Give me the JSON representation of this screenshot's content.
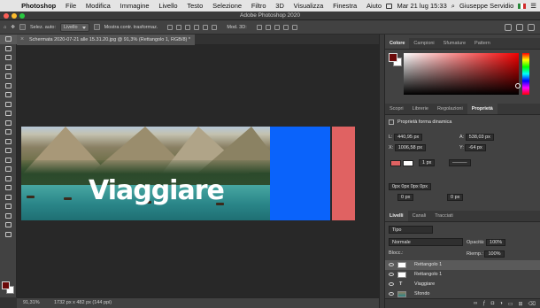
{
  "menubar": {
    "app": "Photoshop",
    "items": [
      "File",
      "Modifica",
      "Immagine",
      "Livello",
      "Testo",
      "Selezione",
      "Filtro",
      "3D",
      "Visualizza",
      "Finestra",
      "Aiuto"
    ],
    "datetime": "Mar 21 lug  15:33",
    "user": "Giuseppe Servidio"
  },
  "window": {
    "title": "Adobe Photoshop 2020"
  },
  "options": {
    "auto_select_label": "Selez. auto:",
    "auto_select_value": "Livello",
    "transform_label": "Mostra contr. trasformaz.",
    "mode_label": "Mod. 3D:"
  },
  "document": {
    "tab_title": "Schermata 2020-07-21 alle 15.31.20.jpg @ 91,3% (Rettangolo 1, RGB/8) *",
    "overlay_text": "Viaggiare",
    "status_zoom": "91,31%",
    "status_size": "1732 px x 482 px (144 ppi)"
  },
  "colors": {
    "blue_rect": "#0a63fb",
    "red_rect": "#e06262",
    "foreground": "#6b0a0a"
  },
  "panel_color": {
    "tabs": [
      "Colore",
      "Campioni",
      "Sfumature",
      "Pattern"
    ]
  },
  "panel_props": {
    "tabs": [
      "Scopri",
      "Librerie",
      "Regolazioni",
      "Proprietà"
    ],
    "header": "Proprietà forma dinamica",
    "w_label": "L:",
    "w_value": "440,95 px",
    "h_label": "A:",
    "h_value": "538,03 px",
    "x_label": "X:",
    "x_value": "1006,58 px",
    "y_label": "Y:",
    "y_value": "-64 px",
    "stroke_size": "1 px",
    "radius_value": "0px 0px 0px 0px",
    "corner_1": "0 px",
    "corner_2": "0 px"
  },
  "panel_layers": {
    "tabs": [
      "Livelli",
      "Canali",
      "Tracciati"
    ],
    "filter_label": "Tipo",
    "blend_mode": "Normale",
    "opacity_label": "Opacità:",
    "opacity_value": "100%",
    "lock_label": "Blocc.:",
    "fill_label": "Riemp.:",
    "fill_value": "100%",
    "layers": [
      {
        "name": "Rettangolo 1",
        "selected": true
      },
      {
        "name": "Rettangolo 1",
        "selected": false
      },
      {
        "name": "Viaggiare",
        "selected": false
      },
      {
        "name": "Sfondo",
        "selected": false
      }
    ]
  }
}
